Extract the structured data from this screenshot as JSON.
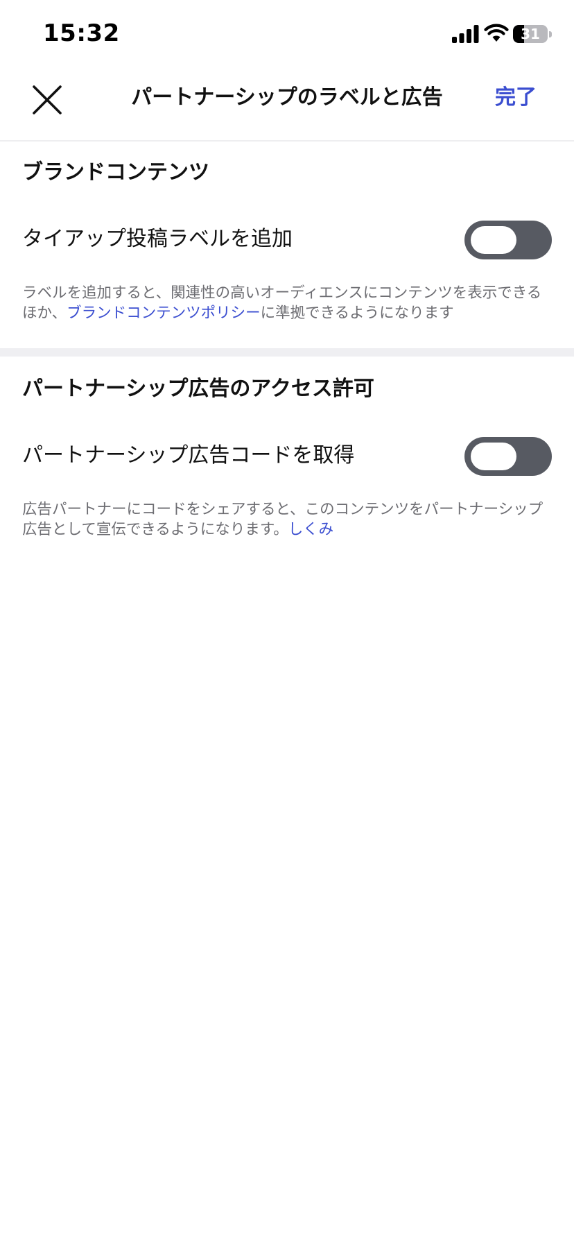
{
  "status_bar": {
    "time": "15:32",
    "battery_level": "31",
    "icons": [
      "signal-icon",
      "wifi-icon",
      "battery-icon"
    ]
  },
  "header": {
    "title": "パートナーシップのラベルと広告",
    "done_label": "完了",
    "close_icon": "close-icon"
  },
  "branded_content": {
    "heading": "ブランドコンテンツ",
    "setting_label": "タイアップ投稿ラベルを追加",
    "toggle_on": false,
    "description_before": "ラベルを追加すると、関連性の高いオーディエンスにコンテンツを表示できるほか、",
    "description_link": "ブランドコンテンツポリシー",
    "description_after": "に準拠できるようになります"
  },
  "partnership_ads": {
    "heading": "パートナーシップ広告のアクセス許可",
    "setting_label": "パートナーシップ広告コードを取得",
    "toggle_on": false,
    "description_before": "広告パートナーにコードをシェアすると、このコンテンツをパートナーシップ広告として宣伝できるようになります。",
    "description_link": "しくみ"
  },
  "colors": {
    "accent": "#3b4ed0",
    "toggle_off": "#575a62",
    "secondary_text": "#6d6d72"
  }
}
